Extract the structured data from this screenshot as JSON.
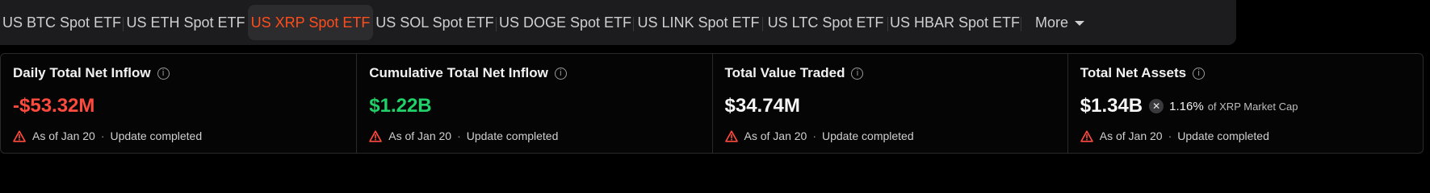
{
  "tabs": [
    {
      "label": "US BTC Spot ETF",
      "active": false
    },
    {
      "label": "US ETH Spot ETF",
      "active": false
    },
    {
      "label": "US XRP Spot ETF",
      "active": true
    },
    {
      "label": "US SOL Spot ETF",
      "active": false
    },
    {
      "label": "US DOGE Spot ETF",
      "active": false
    },
    {
      "label": "US LINK Spot ETF",
      "active": false
    },
    {
      "label": "US LTC Spot ETF",
      "active": false
    },
    {
      "label": "US HBAR Spot ETF",
      "active": false
    },
    {
      "label": "More",
      "active": false
    }
  ],
  "colors": {
    "accent": "#ff4d1c",
    "negative": "#ff4a3d",
    "positive": "#1fd168",
    "warning": "#ff4a3d"
  },
  "cards": [
    {
      "title": "Daily Total Net Inflow",
      "value": "-$53.32M",
      "status_date": "As of Jan 20",
      "status_text": "Update completed"
    },
    {
      "title": "Cumulative Total Net Inflow",
      "value": "$1.22B",
      "status_date": "As of Jan 20",
      "status_text": "Update completed"
    },
    {
      "title": "Total Value Traded",
      "value": "$34.74M",
      "status_date": "As of Jan 20",
      "status_text": "Update completed"
    },
    {
      "title": "Total Net Assets",
      "value": "$1.34B",
      "market_cap_pct": "1.16%",
      "market_cap_label": "of XRP Market Cap",
      "status_date": "As of Jan 20",
      "status_text": "Update completed"
    }
  ],
  "icons": {
    "info": "i",
    "xrp": "✕",
    "separator": "·"
  }
}
